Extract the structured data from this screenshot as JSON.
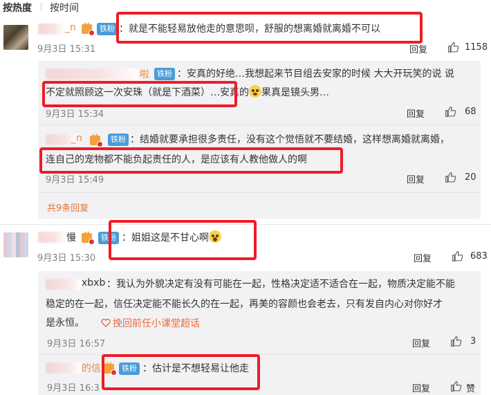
{
  "sort": {
    "hot": "按热度",
    "time": "按时间"
  },
  "badge": "铁粉",
  "reply_label": "回复",
  "comments": [
    {
      "name_tail": "_n",
      "text": "：就是不能轻易放他走的意思呗，舒服的想离婚就离婚不可以",
      "time": "9月3日 15:31",
      "likes": "1158"
    },
    {
      "name_tail": "慢",
      "text": "：姐姐这是不甘心啊",
      "time": "9月3日 15:30",
      "likes": "683"
    },
    {
      "name_tail": "xbxb",
      "text_line1": "：我认为外貌决定有没有可能在一起，性格决定适不适合在一起，物质决定能不能",
      "text_line2": "稳定的在一起，信任决定能不能长久的在一起，再美的容颜也会老去，只有发自内心对你好才",
      "text_line3": "是永恒。",
      "chaohua": "挽回前任小课堂超话",
      "time": "9月3日 16:57",
      "likes": "3"
    },
    {
      "name_tail": "的信",
      "text": "：估计是不想轻易让他走",
      "time": "9月3日 16:3",
      "likes": "赞"
    }
  ],
  "subreplies": [
    {
      "name_tail": "啦",
      "text_line1": "：安真的好绝…我想起来节目组去安家的时候 大大开玩笑的说 说",
      "text_line2a": "不定就照顾这一次安珠（就是下酒菜）…安真的",
      "text_line2b": "果真是镜头男…",
      "time": "9月3日 15:34",
      "likes": "68"
    },
    {
      "name_tail": "_n",
      "text_line1": "：结婚就要承担很多责任，没有这个觉悟就不要结婚，这样想离婚就离婚，",
      "text_line2": "连自己的宠物都不能负起责任的人，是应该有人教他做人的啊",
      "time": "9月3日 15:49",
      "likes": "20"
    }
  ],
  "more_replies": "共9条回复",
  "colors": {
    "highlight_box": "#ee1c25",
    "fan_badge": "#4a9bd8",
    "link_orange": "#e4752b"
  }
}
